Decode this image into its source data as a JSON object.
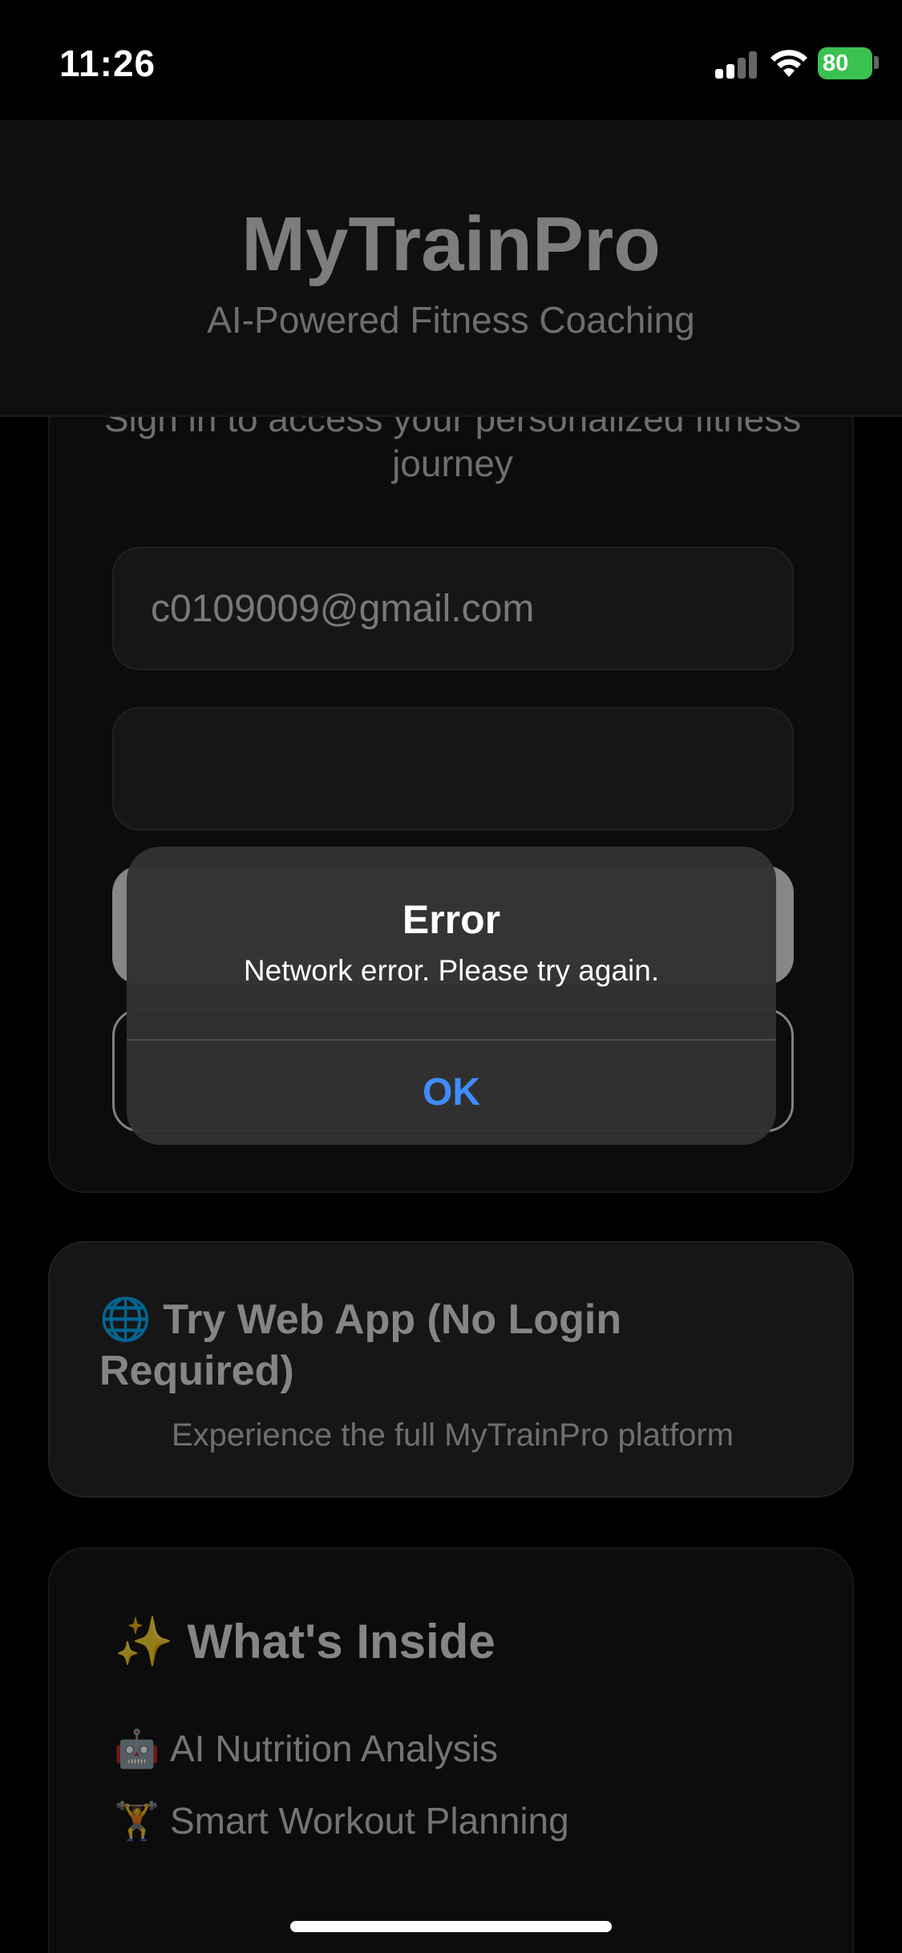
{
  "status_bar": {
    "time": "11:26",
    "battery": "80",
    "signal_icon": "cellular-signal-icon",
    "wifi_icon": "wifi-icon",
    "battery_color": "#3ac152"
  },
  "header": {
    "title": "MyTrainPro",
    "subtitle": "AI-Powered Fitness Coaching"
  },
  "signin": {
    "prompt": "Sign in to access your personalized fitness journey",
    "email_value": "c0109009@gmail.com",
    "password_value": ""
  },
  "web_app": {
    "icon": "globe-icon",
    "title": "🌐 Try Web App (No Login Required)",
    "subtitle": "Experience the full MyTrainPro platform"
  },
  "inside": {
    "title": "✨ What's Inside",
    "features": [
      {
        "icon": "robot-icon",
        "emoji": "🤖",
        "label": "AI Nutrition Analysis"
      },
      {
        "icon": "weightlifter-icon",
        "emoji": "🏋",
        "label": "Smart Workout Planning"
      }
    ]
  },
  "alert": {
    "title": "Error",
    "message": "Network error. Please try again.",
    "ok_label": "OK",
    "accent": "#3f8cff"
  }
}
